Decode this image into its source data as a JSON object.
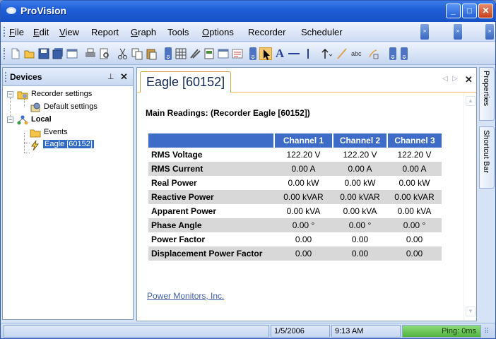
{
  "window": {
    "title": "ProVision",
    "min_glyph": "_",
    "max_glyph": "□",
    "close_glyph": "✕"
  },
  "menu": {
    "items": [
      {
        "label": "File",
        "accel": "F",
        "rest": "ile"
      },
      {
        "label": "Edit",
        "accel": "E",
        "rest": "dit"
      },
      {
        "label": "View",
        "accel": "V",
        "rest": "iew"
      },
      {
        "label": "Report",
        "accel": "",
        "rest": "Report"
      },
      {
        "label": "Graph",
        "accel": "G",
        "rest": "raph"
      },
      {
        "label": "Tools",
        "accel": "",
        "rest": "Tools"
      },
      {
        "label": "Options",
        "accel": "O",
        "rest": "ptions"
      },
      {
        "label": "Recorder",
        "accel": "",
        "rest": "Recorder"
      },
      {
        "label": "Scheduler",
        "accel": "",
        "rest": "Scheduler"
      }
    ]
  },
  "toolbar": {
    "icons": [
      "new-icon",
      "open-icon",
      "save-icon",
      "save-all-icon",
      "window-icon",
      "print-icon",
      "print-preview-icon",
      "cut-icon",
      "copy-icon",
      "paste-icon",
      "grid-icon",
      "tools-icon",
      "report-icon",
      "window-icon",
      "notes-icon",
      "pointer-icon",
      "text-icon",
      "line-icon",
      "vline-icon",
      "arrow-icon",
      "slash-icon",
      "abc-icon",
      "shape-icon"
    ],
    "text_tool_glyph": "A",
    "abc_glyph": "abc"
  },
  "devices": {
    "title": "Devices",
    "pin_glyph": "ᵖ",
    "close_glyph": "✕",
    "tree": [
      {
        "label": "Recorder settings",
        "level": 0
      },
      {
        "label": "Default settings",
        "level": 1
      },
      {
        "label": "Local",
        "level": 0
      },
      {
        "label": "Events",
        "level": 1
      },
      {
        "label": "Eagle [60152]",
        "level": 1
      }
    ]
  },
  "document": {
    "tab_label": "Eagle [60152]",
    "nav_left": "◁",
    "nav_right": "▷",
    "close_glyph": "✕",
    "title": "Main Readings: (Recorder Eagle [60152])",
    "columns": [
      "Channel 1",
      "Channel 2",
      "Channel 3"
    ],
    "rows": [
      {
        "label": "RMS Voltage",
        "values": [
          "122.20 V",
          "122.20 V",
          "122.20 V"
        ]
      },
      {
        "label": "RMS Current",
        "values": [
          "0.00 A",
          "0.00 A",
          "0.00 A"
        ]
      },
      {
        "label": "Real Power",
        "values": [
          "0.00 kW",
          "0.00 kW",
          "0.00 kW"
        ]
      },
      {
        "label": "Reactive Power",
        "values": [
          "0.00 kVAR",
          "0.00 kVAR",
          "0.00 kVAR"
        ]
      },
      {
        "label": "Apparent Power",
        "values": [
          "0.00 kVA",
          "0.00 kVA",
          "0.00 kVA"
        ]
      },
      {
        "label": "Phase Angle",
        "values": [
          "0.00 °",
          "0.00 °",
          "0.00 °"
        ]
      },
      {
        "label": "Power Factor",
        "values": [
          "0.00",
          "0.00",
          "0.00"
        ]
      },
      {
        "label": "Displacement Power Factor",
        "values": [
          "0.00",
          "0.00",
          "0.00"
        ]
      }
    ],
    "footer_link": "Power Monitors, Inc."
  },
  "side_tabs": [
    "Properties",
    "Shortcut Bar"
  ],
  "status": {
    "date": "1/5/2006",
    "time": "9:13 AM",
    "ping": "Ping: 0ms",
    "grip": "⠿"
  },
  "colors": {
    "header_blue": "#3d6cc8",
    "ping_green": "#4fb23d",
    "title_blue": "#1e5fd8"
  }
}
